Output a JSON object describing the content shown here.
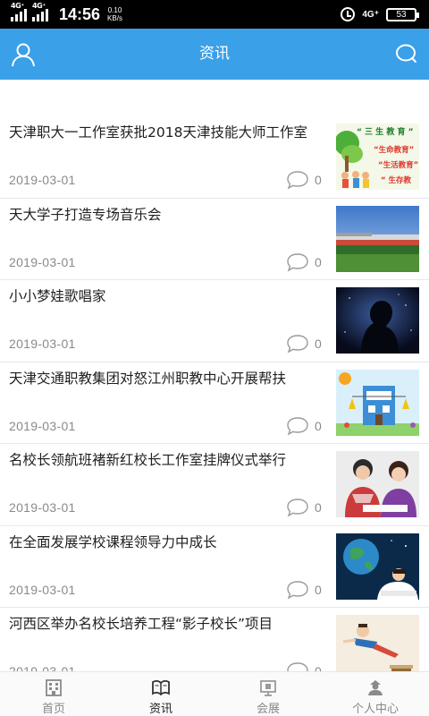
{
  "status_bar": {
    "network_1": "4G⁺",
    "network_2": "4G⁺",
    "time": "14:56",
    "speed_value": "0.10",
    "speed_unit": "KB/s",
    "network_right": "4G⁺",
    "battery": "53"
  },
  "header": {
    "title": "资讯",
    "left_icon": "user-icon",
    "right_icon": "search-icon",
    "color": "#3aa0e8"
  },
  "articles": [
    {
      "title": "天津职大一工作室获批2018天津技能大师工作室",
      "date": "2019-03-01",
      "comments": "0",
      "thumb": "education-poster"
    },
    {
      "title": "天大学子打造专场音乐会",
      "date": "2019-03-01",
      "comments": "0",
      "thumb": "stadium"
    },
    {
      "title": "小小梦娃歌唱家",
      "date": "2019-03-01",
      "comments": "0",
      "thumb": "dreamer-silhouette"
    },
    {
      "title": "天津交通职教集团对怒江州职教中心开展帮扶",
      "date": "2019-03-01",
      "comments": "0",
      "thumb": "school-illustration"
    },
    {
      "title": "名校长领航班褚新红校长工作室挂牌仪式举行",
      "date": "2019-03-01",
      "comments": "0",
      "thumb": "students-studying"
    },
    {
      "title": "在全面发展学校课程领导力中成长",
      "date": "2019-03-01",
      "comments": "0",
      "thumb": "globe-student"
    },
    {
      "title": "河西区举办名校长培养工程“影子校长”项目",
      "date": "2019-03-01",
      "comments": "0",
      "thumb": "flying-boy"
    }
  ],
  "thumb_texts": {
    "line1": "“ 三 生 教 育 ”",
    "line2": "“生命教育”",
    "line3": "“生活教育”",
    "line4": "“ 生存教"
  },
  "tabs": [
    {
      "label": "首页",
      "icon": "building-icon"
    },
    {
      "label": "资讯",
      "icon": "book-icon",
      "active": true
    },
    {
      "label": "会展",
      "icon": "exhibition-icon"
    },
    {
      "label": "个人中心",
      "icon": "person-icon"
    }
  ]
}
